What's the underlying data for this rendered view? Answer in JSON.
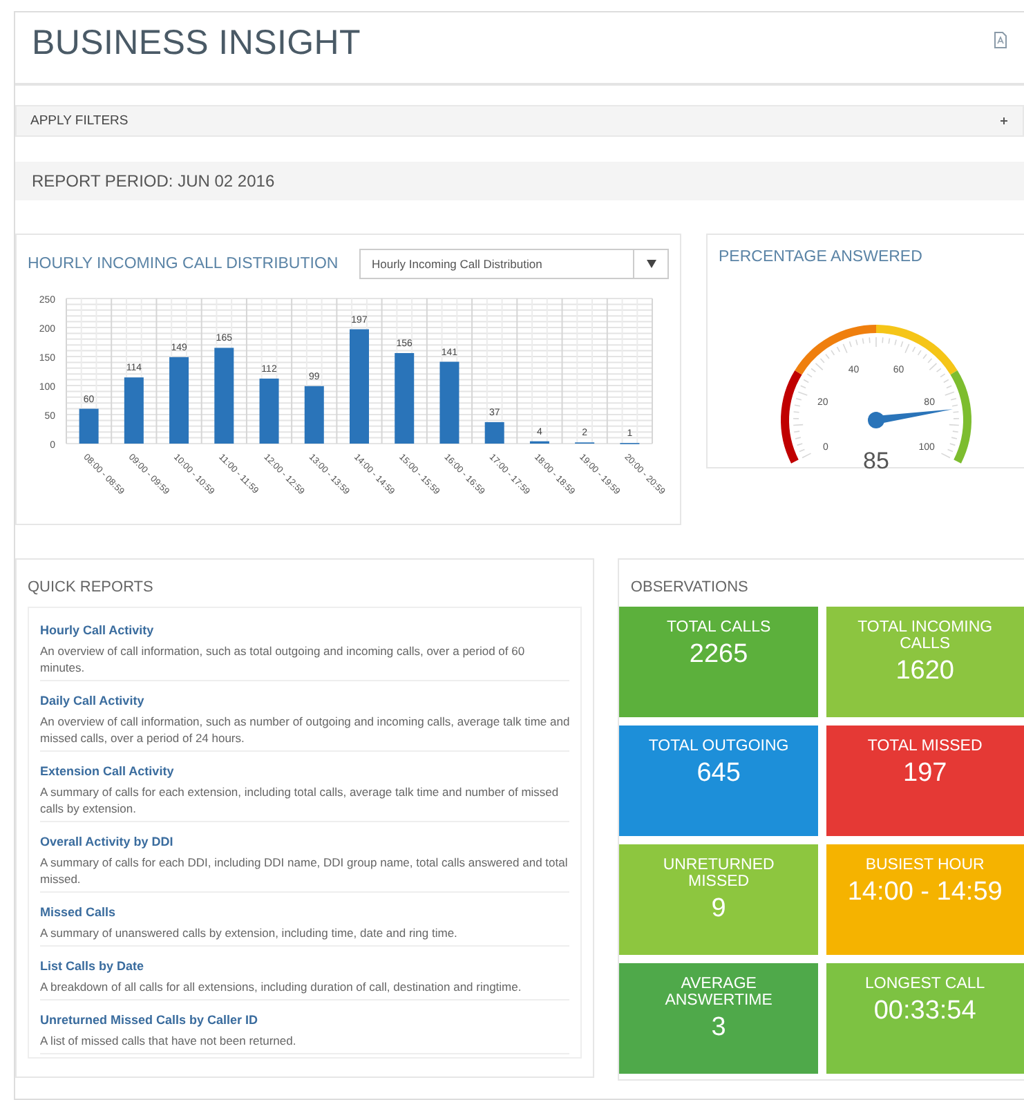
{
  "header": {
    "title": "BUSINESS INSIGHT"
  },
  "filters": {
    "label": "APPLY FILTERS"
  },
  "report_period": "REPORT PERIOD: JUN 02 2016",
  "hourly_chart": {
    "title": "HOURLY INCOMING CALL DISTRIBUTION",
    "dropdown": {
      "value": "Hourly Incoming Call Distribution"
    },
    "chart_data": {
      "type": "bar",
      "categories": [
        "08:00 - 08:59",
        "09:00 - 09:59",
        "10:00 - 10:59",
        "11:00 - 11:59",
        "12:00 - 12:59",
        "13:00 - 13:59",
        "14:00 - 14:59",
        "15:00 - 15:59",
        "16:00 - 16:59",
        "17:00 - 17:59",
        "18:00 - 18:59",
        "19:00 - 19:59",
        "20:00 - 20:59"
      ],
      "values": [
        60,
        114,
        149,
        165,
        112,
        99,
        197,
        156,
        141,
        37,
        4,
        2,
        1
      ],
      "ylim": [
        0,
        250
      ],
      "yticks": [
        0,
        50,
        100,
        150,
        200,
        250
      ],
      "data_labels": true,
      "grid": true
    }
  },
  "gauge": {
    "title": "PERCENTAGE ANSWERED",
    "reading": "85",
    "ticks": [
      "0",
      "20",
      "40",
      "60",
      "80",
      "100"
    ]
  },
  "quick_reports": {
    "title": "QUICK REPORTS",
    "items": [
      {
        "title": "Hourly Call Activity",
        "description": "An overview of call information, such as total outgoing and incoming calls, over a period of 60 minutes."
      },
      {
        "title": "Daily Call Activity",
        "description": "An overview of call information, such as number of outgoing and incoming calls, average talk time and missed calls, over a period of 24 hours."
      },
      {
        "title": "Extension Call Activity",
        "description": "A summary of calls for each extension, including total calls, average talk time and number of missed calls by extension."
      },
      {
        "title": "Overall Activity by DDI",
        "description": "A summary of calls for each DDI, including DDI name, DDI group name, total calls answered and total missed."
      },
      {
        "title": "Missed Calls",
        "description": "A summary of unanswered calls by extension, including time, date and ring time."
      },
      {
        "title": "List Calls by Date",
        "description": "A breakdown of all calls for all extensions, including duration of call, destination and ringtime."
      },
      {
        "title": "Unreturned Missed Calls by Caller ID",
        "description": "A list of missed calls that have not been returned."
      }
    ]
  },
  "observations": {
    "title": "OBSERVATIONS",
    "tiles": [
      {
        "label": "TOTAL CALLS",
        "value": "2265",
        "color": "#5cb03c"
      },
      {
        "label": "TOTAL INCOMING CALLS",
        "value": "1620",
        "color": "#8cc540"
      },
      {
        "label": "TOTAL OUTGOING",
        "value": "645",
        "color": "#1d8fd9"
      },
      {
        "label": "TOTAL MISSED",
        "value": "197",
        "color": "#e53935"
      },
      {
        "label": "UNRETURNED MISSED",
        "value": "9",
        "color": "#8dc63f"
      },
      {
        "label": "BUSIEST HOUR",
        "value": "14:00 - 14:59",
        "color": "#f5b300"
      },
      {
        "label": "AVERAGE ANSWERTIME",
        "value": "3",
        "color": "#4fa94a"
      },
      {
        "label": "LONGEST CALL",
        "value": "00:33:54",
        "color": "#7dc242"
      }
    ]
  }
}
